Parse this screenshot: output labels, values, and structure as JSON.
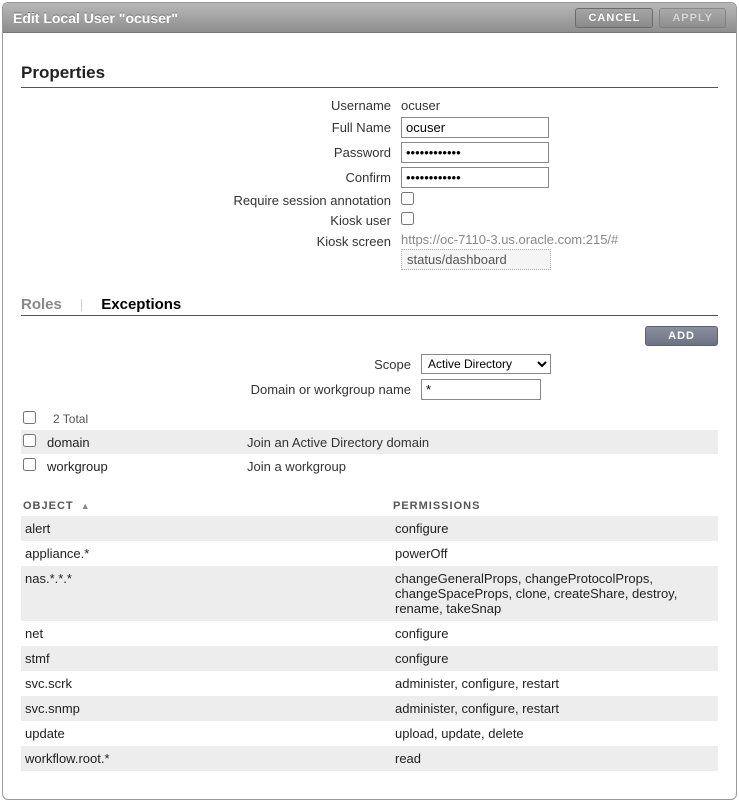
{
  "titlebar": {
    "title": "Edit Local User \"ocuser\"",
    "cancel": "CANCEL",
    "apply": "APPLY"
  },
  "sections": {
    "properties": "Properties"
  },
  "properties": {
    "username_label": "Username",
    "username_value": "ocuser",
    "fullname_label": "Full Name",
    "fullname_value": "ocuser",
    "password_label": "Password",
    "password_value": "••••••••••••",
    "confirm_label": "Confirm",
    "confirm_value": "••••••••••••",
    "require_session_label": "Require session annotation",
    "kiosk_user_label": "Kiosk user",
    "kiosk_screen_label": "Kiosk screen",
    "kiosk_url_prefix": "https://oc-7110-3.us.oracle.com:215/#",
    "kiosk_path": "status/dashboard"
  },
  "tabs": {
    "roles": "Roles",
    "exceptions": "Exceptions"
  },
  "exceptions": {
    "add": "ADD",
    "scope_label": "Scope",
    "scope_selected": "Active Directory",
    "domain_label": "Domain or workgroup name",
    "domain_filter": "*",
    "total": "2 Total",
    "rows": [
      {
        "name": "domain",
        "desc": "Join an Active Directory domain"
      },
      {
        "name": "workgroup",
        "desc": "Join a workgroup"
      }
    ]
  },
  "perm_table": {
    "object_header": "OBJECT",
    "permissions_header": "PERMISSIONS",
    "rows": [
      {
        "obj": "alert",
        "perm": "configure"
      },
      {
        "obj": "appliance.*",
        "perm": "powerOff"
      },
      {
        "obj": "nas.*.*.*",
        "perm": "changeGeneralProps, changeProtocolProps, changeSpaceProps, clone, createShare, destroy, rename, takeSnap"
      },
      {
        "obj": "net",
        "perm": "configure"
      },
      {
        "obj": "stmf",
        "perm": "configure"
      },
      {
        "obj": "svc.scrk",
        "perm": "administer, configure, restart"
      },
      {
        "obj": "svc.snmp",
        "perm": "administer, configure, restart"
      },
      {
        "obj": "update",
        "perm": "upload, update, delete"
      },
      {
        "obj": "workflow.root.*",
        "perm": "read"
      }
    ]
  }
}
